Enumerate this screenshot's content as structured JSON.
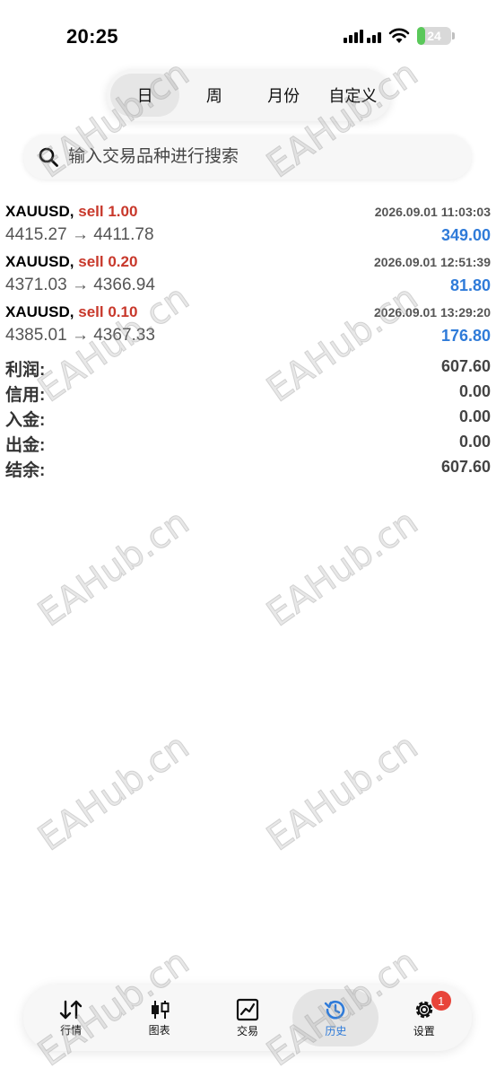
{
  "status_bar": {
    "time": "20:25",
    "battery_level": "24",
    "battery_percent": 24,
    "battery_color": "#5ac85a"
  },
  "period_tabs": [
    {
      "label": "日",
      "active": true
    },
    {
      "label": "周",
      "active": false
    },
    {
      "label": "月份",
      "active": false
    },
    {
      "label": "自定义",
      "active": false
    }
  ],
  "search": {
    "placeholder": "输入交易品种进行搜索",
    "icon": "search-icon"
  },
  "trades": [
    {
      "symbol": "XAUUSD,",
      "side": "sell 1.00",
      "time": "2026.09.01 11:03:03",
      "prices": "4415.27 → 4411.78",
      "profit": "349.00"
    },
    {
      "symbol": "XAUUSD,",
      "side": "sell 0.20",
      "time": "2026.09.01 12:51:39",
      "prices": "4371.03 → 4366.94",
      "profit": "81.80"
    },
    {
      "symbol": "XAUUSD,",
      "side": "sell 0.10",
      "time": "2026.09.01 13:29:20",
      "prices": "4385.01 → 4367.33",
      "profit": "176.80"
    }
  ],
  "summary": {
    "profit": {
      "label": "利润:",
      "value": "607.60"
    },
    "credit": {
      "label": "信用:",
      "value": "0.00"
    },
    "deposit": {
      "label": "入金:",
      "value": "0.00"
    },
    "withdrawal": {
      "label": "出金:",
      "value": "0.00"
    },
    "balance": {
      "label": "结余:",
      "value": "607.60"
    }
  },
  "watermark": "EAHub.cn",
  "tabbar": [
    {
      "label": "行情",
      "icon": "quotes-arrows-icon",
      "active": false
    },
    {
      "label": "图表",
      "icon": "candlestick-chart-icon",
      "active": false
    },
    {
      "label": "交易",
      "icon": "trade-chart-icon",
      "active": false
    },
    {
      "label": "历史",
      "icon": "history-clock-icon",
      "active": true
    },
    {
      "label": "设置",
      "icon": "gear-icon",
      "active": false,
      "badge": "1"
    }
  ],
  "colors": {
    "sell": "#c8382b",
    "profit": "#2f7bd9",
    "active_tab": "#2f7bd9",
    "badge": "#e8443a"
  }
}
